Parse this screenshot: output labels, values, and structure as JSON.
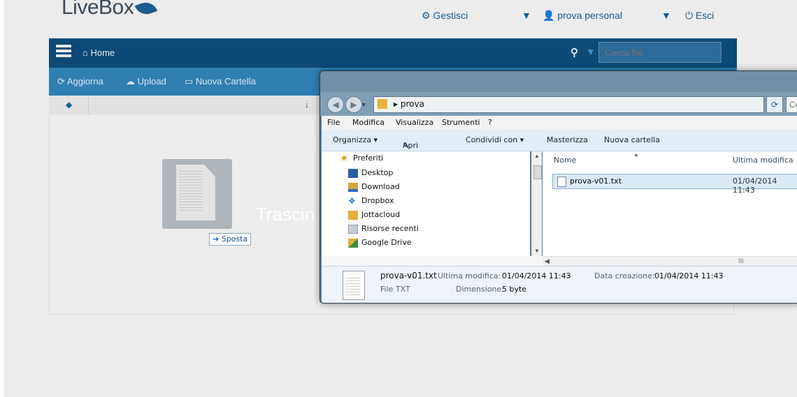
{
  "app": {
    "logo": "LiveBox",
    "topnav": {
      "manage": "Gestisci",
      "user": "prova personal",
      "logout": "Esci"
    },
    "navbar": {
      "home": "Home",
      "search_placeholder": "Cerca file"
    },
    "toolbar": {
      "refresh": "Aggiorna",
      "upload": "Upload",
      "new_folder": "Nuova Cartella"
    },
    "drop_hint_visible": "Trascin",
    "drag_badge": "Sposta"
  },
  "explorer": {
    "address": {
      "crumb": "prova",
      "search_placeholder": "Ce"
    },
    "menu": [
      "File",
      "Modifica",
      "Visualizza",
      "Strumenti",
      "?"
    ],
    "commands": {
      "organize": "Organizza ▾",
      "open": "Apri ▾",
      "share": "Condividi con ▾",
      "burn": "Masterizza",
      "new_folder": "Nuova cartella"
    },
    "nav_items": [
      {
        "label": "Preferiti",
        "icon": "star-icon"
      },
      {
        "label": "Desktop",
        "icon": "desktop-icon"
      },
      {
        "label": "Download",
        "icon": "download-folder-icon"
      },
      {
        "label": "Dropbox",
        "icon": "dropbox-icon"
      },
      {
        "label": "Jottacloud",
        "icon": "folder-icon"
      },
      {
        "label": "Risorse recenti",
        "icon": "recent-places-icon"
      },
      {
        "label": "Google Drive",
        "icon": "google-drive-icon"
      }
    ],
    "columns": {
      "name": "Nome",
      "modified": "Ultima modifica"
    },
    "files": [
      {
        "name": "prova-v01.txt",
        "modified": "01/04/2014 11:43"
      }
    ],
    "hscroll_grip": "III",
    "details": {
      "filename": "prova-v01.txt",
      "type": "File TXT",
      "modified_label": "Ultima modifica:",
      "modified_value": "01/04/2014 11:43",
      "size_label": "Dimensione:",
      "size_value": "5 byte",
      "created_label": "Data creazione:",
      "created_value": "01/04/2014 11:43"
    }
  },
  "colors": {
    "navbar": "#0d4a75",
    "toolbar": "#2f7fb3",
    "accent": "#1a5d8e",
    "explorer_frame": "#5a7d93"
  }
}
